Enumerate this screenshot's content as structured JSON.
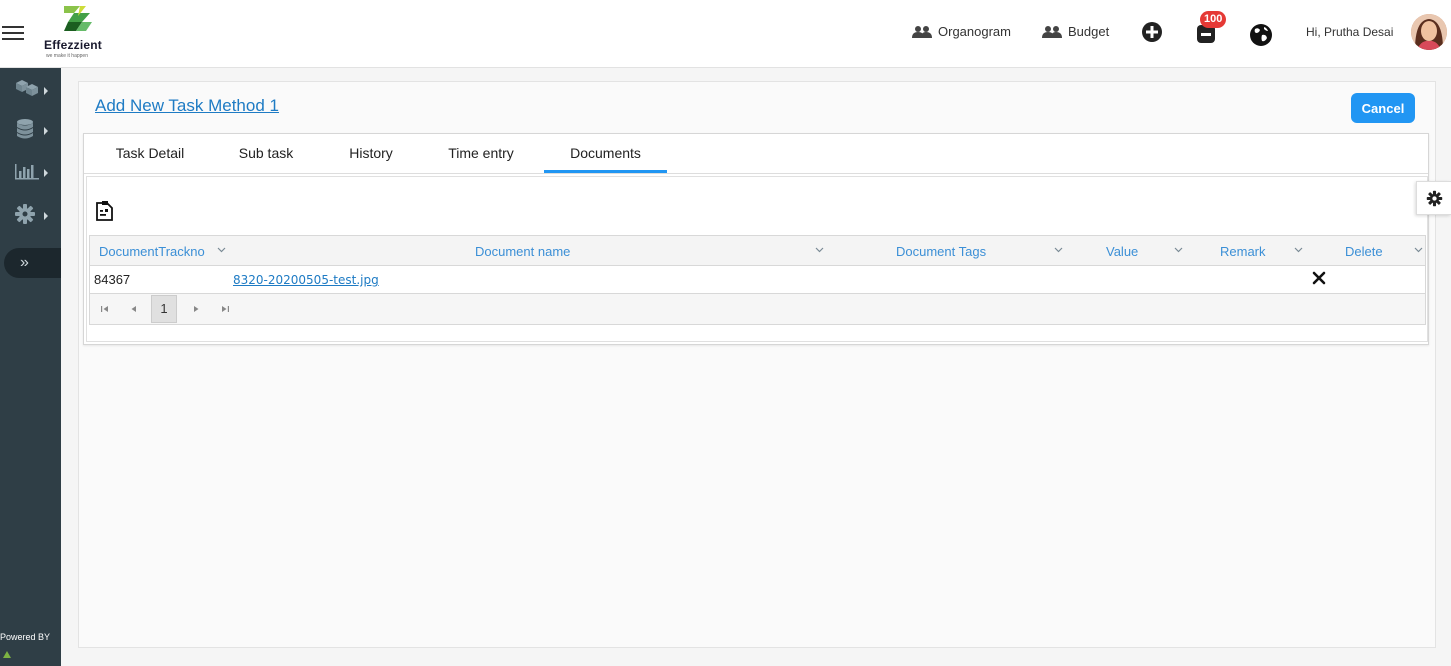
{
  "header": {
    "brand_name": "Effezzient",
    "brand_tagline": "we make it happen",
    "nav": [
      {
        "label": "Organogram",
        "icon": "users-icon"
      },
      {
        "label": "Budget",
        "icon": "users-icon"
      }
    ],
    "notification_count": "100",
    "greeting": "Hi, Prutha Desai"
  },
  "sidebar": {
    "items": [
      {
        "icon": "cubes-icon"
      },
      {
        "icon": "database-icon"
      },
      {
        "icon": "bar-chart-icon"
      },
      {
        "icon": "gear-icon"
      }
    ],
    "collapse_label": "»",
    "powered_by": "Powered BY"
  },
  "page": {
    "title": "Add New Task Method 1",
    "cancel_label": "Cancel",
    "tabs": [
      "Task Detail",
      "Sub task",
      "History",
      "Time entry",
      "Documents"
    ],
    "active_tab": "Documents"
  },
  "documents_table": {
    "columns": [
      "DocumentTrackno",
      "Document name",
      "Document Tags",
      "Value",
      "Remark",
      "Delete"
    ],
    "rows": [
      {
        "trackno": "84367",
        "name": "8320-20200505-test.jpg",
        "tags": "",
        "value": "",
        "remark": ""
      }
    ],
    "current_page": "1"
  },
  "colors": {
    "accent": "#2196f3",
    "link": "#1e7bc4",
    "sidebar": "#2f3e46",
    "badge": "#e53935"
  }
}
